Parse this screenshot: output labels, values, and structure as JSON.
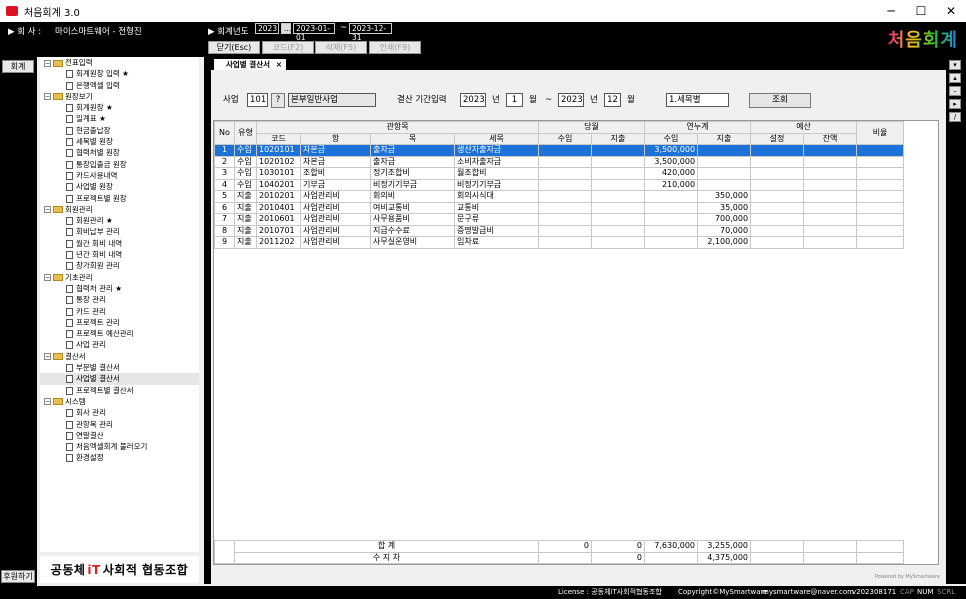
{
  "window": {
    "title": "처음회계 3.0"
  },
  "header": {
    "company_label": "▶ 회 사 :",
    "company_name": "마이스마트웨어 - 전형진",
    "fiscal_label": "▶ 회계년도",
    "fiscal_year": "2023",
    "start_date": "2023-01-01",
    "tilde": "~",
    "end_date": "2023-12-31",
    "btn_dots": "...",
    "toolbar": {
      "close": "닫기(Esc)",
      "code": "코드(F2)",
      "delete": "삭제(F5)",
      "print": "인쇄(F9)"
    },
    "brand": "처음회계"
  },
  "side_buttons": {
    "accounting": "회계",
    "support": "후원하기"
  },
  "tree": [
    {
      "kind": "group",
      "label": "전표입력"
    },
    {
      "kind": "leaf",
      "label": "회계원장 입력 ★"
    },
    {
      "kind": "leaf",
      "label": "은행엑셀 입력"
    },
    {
      "kind": "group",
      "label": "원장보기"
    },
    {
      "kind": "leaf",
      "label": "회계원장 ★"
    },
    {
      "kind": "leaf",
      "label": "일계표 ★"
    },
    {
      "kind": "leaf",
      "label": "현금출납장"
    },
    {
      "kind": "leaf",
      "label": "세목별 원장"
    },
    {
      "kind": "leaf",
      "label": "협력처별 원장"
    },
    {
      "kind": "leaf",
      "label": "통장입출금 원장"
    },
    {
      "kind": "leaf",
      "label": "카드사용내역"
    },
    {
      "kind": "leaf",
      "label": "사업별 원장"
    },
    {
      "kind": "leaf",
      "label": "프로젝트별 원장"
    },
    {
      "kind": "group",
      "label": "회원관리"
    },
    {
      "kind": "leaf",
      "label": "회원관리 ★"
    },
    {
      "kind": "leaf",
      "label": "회비납부 관리"
    },
    {
      "kind": "leaf",
      "label": "월간 회비 내역"
    },
    {
      "kind": "leaf",
      "label": "년간 회비 내역"
    },
    {
      "kind": "leaf",
      "label": "창가회원 관리"
    },
    {
      "kind": "group",
      "label": "기초관리"
    },
    {
      "kind": "leaf",
      "label": "협력처 관리 ★"
    },
    {
      "kind": "leaf",
      "label": "통장 관리"
    },
    {
      "kind": "leaf",
      "label": "카드 관리"
    },
    {
      "kind": "leaf",
      "label": "프로젝트 관리"
    },
    {
      "kind": "leaf",
      "label": "프로젝트 예산관리"
    },
    {
      "kind": "leaf",
      "label": "사업 관리"
    },
    {
      "kind": "group",
      "label": "결산서"
    },
    {
      "kind": "leaf",
      "label": "부문별 결산서"
    },
    {
      "kind": "leaf",
      "label": "사업별 결산서",
      "selected": true
    },
    {
      "kind": "leaf",
      "label": "프로젝트별 결산서"
    },
    {
      "kind": "group",
      "label": "시스템"
    },
    {
      "kind": "leaf",
      "label": "회사 관리"
    },
    {
      "kind": "leaf",
      "label": "관항목 관리"
    },
    {
      "kind": "leaf",
      "label": "연말결산"
    },
    {
      "kind": "leaf",
      "label": "처음엑셀회계 불러오기"
    },
    {
      "kind": "leaf",
      "label": "환경설정"
    }
  ],
  "coop": {
    "pre": "공동체",
    "it": "iT",
    "post": "사회적 협동조합"
  },
  "tab": {
    "label": "사업별 결산서",
    "close": "×"
  },
  "filters": {
    "biz_label": "사업",
    "biz_code": "101",
    "biz_help": "?",
    "biz_name": "본부일반사업",
    "period_label": "결산 기간입력",
    "year_from": "2023",
    "year_unit": "년",
    "month_from": "1",
    "month_unit": "월",
    "tilde": "~",
    "year_to": "2023",
    "month_to": "12",
    "mode": "1.세목별",
    "search_btn": "조회"
  },
  "table": {
    "h_no": "No",
    "h_type": "유형",
    "h_gwan": "관항목",
    "h_month": "당월",
    "h_cum": "연누계",
    "h_budget": "예산",
    "h_ratio": "비율",
    "h_code": "코드",
    "h_hang": "항",
    "h_mok": "목",
    "h_semok": "세목",
    "h_in": "수입",
    "h_out": "지출",
    "h_cin": "수입",
    "h_cout": "지출",
    "h_set": "설정",
    "h_rem": "잔액",
    "rows": [
      {
        "no": "1",
        "type": "수입",
        "code": "1020101",
        "hang": "자본금",
        "mok": "출자금",
        "semok": "생산자출자금",
        "min": "",
        "mout": "",
        "cin": "3,500,000",
        "cout": ""
      },
      {
        "no": "2",
        "type": "수입",
        "code": "1020102",
        "hang": "자본금",
        "mok": "출자금",
        "semok": "소비자출자금",
        "min": "",
        "mout": "",
        "cin": "3,500,000",
        "cout": ""
      },
      {
        "no": "3",
        "type": "수입",
        "code": "1030101",
        "hang": "조합비",
        "mok": "정기조합비",
        "semok": "월조합비",
        "min": "",
        "mout": "",
        "cin": "420,000",
        "cout": ""
      },
      {
        "no": "4",
        "type": "수입",
        "code": "1040201",
        "hang": "기부금",
        "mok": "비정기기부금",
        "semok": "비정기기부금",
        "min": "",
        "mout": "",
        "cin": "210,000",
        "cout": ""
      },
      {
        "no": "5",
        "type": "지출",
        "code": "2010201",
        "hang": "사업관리비",
        "mok": "회의비",
        "semok": "회의시식대",
        "min": "",
        "mout": "",
        "cin": "",
        "cout": "350,000"
      },
      {
        "no": "6",
        "type": "지출",
        "code": "2010401",
        "hang": "사업관리비",
        "mok": "여비교통비",
        "semok": "교통비",
        "min": "",
        "mout": "",
        "cin": "",
        "cout": "35,000"
      },
      {
        "no": "7",
        "type": "지출",
        "code": "2010601",
        "hang": "사업관리비",
        "mok": "사무용품비",
        "semok": "문구류",
        "min": "",
        "mout": "",
        "cin": "",
        "cout": "700,000"
      },
      {
        "no": "8",
        "type": "지출",
        "code": "2010701",
        "hang": "사업관리비",
        "mok": "지급수수료",
        "semok": "증명발급비",
        "min": "",
        "mout": "",
        "cin": "",
        "cout": "70,000"
      },
      {
        "no": "9",
        "type": "지출",
        "code": "2011202",
        "hang": "사업관리비",
        "mok": "사무실운영비",
        "semok": "임차료",
        "min": "",
        "mout": "",
        "cin": "",
        "cout": "2,100,000"
      }
    ],
    "total_label": "합 계",
    "total_min": "0",
    "total_mout": "0",
    "total_cin": "7,630,000",
    "total_cout": "3,255,000",
    "balance_label": "수 지 차",
    "balance_m": "0",
    "balance_c": "4,375,000"
  },
  "status": {
    "license": "License : 공동체iT사회적협동조합",
    "copyright": "Copyright©MySmartware",
    "email": "mysmartware@naver.com",
    "version": "v202308171",
    "cap": "CAP",
    "num": "NUM",
    "scrl": "SCRL",
    "powered": "Powered by MySmartware"
  },
  "colors": {
    "selection": "#1c72d6",
    "background": "#000000"
  }
}
